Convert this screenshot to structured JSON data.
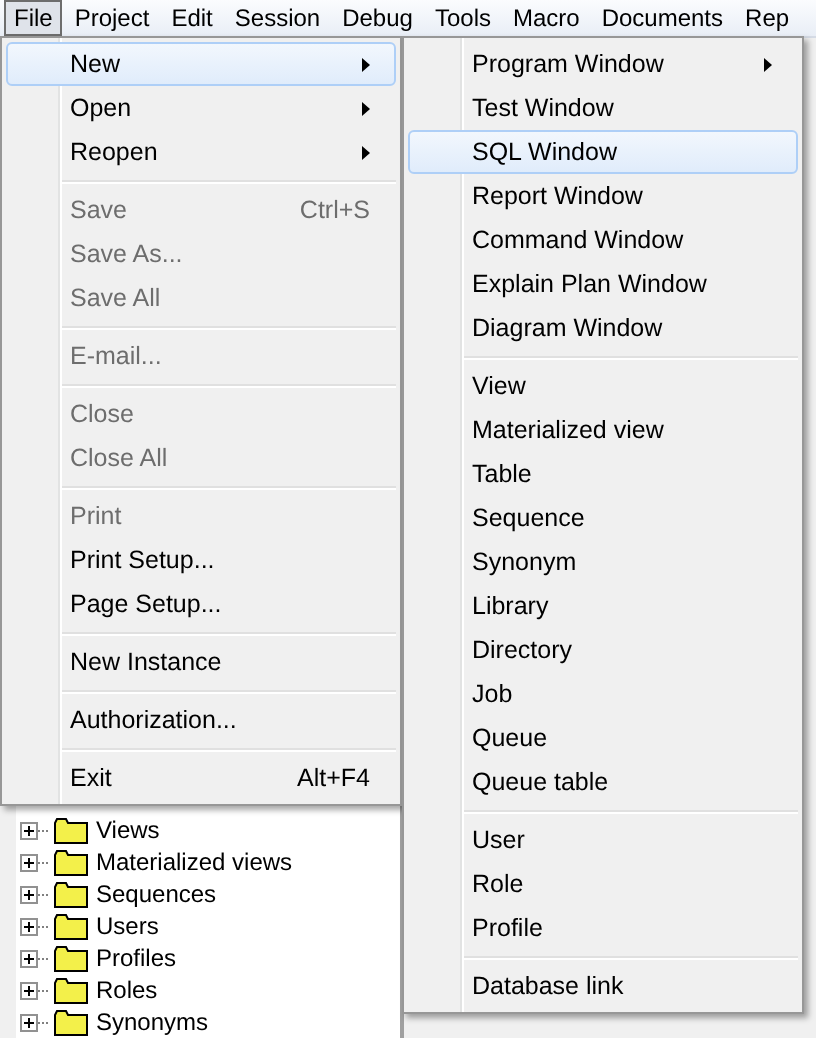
{
  "menubar": [
    {
      "label": "File",
      "selected": true
    },
    {
      "label": "Project",
      "selected": false
    },
    {
      "label": "Edit",
      "selected": false
    },
    {
      "label": "Session",
      "selected": false
    },
    {
      "label": "Debug",
      "selected": false
    },
    {
      "label": "Tools",
      "selected": false
    },
    {
      "label": "Macro",
      "selected": false
    },
    {
      "label": "Documents",
      "selected": false
    },
    {
      "label": "Rep",
      "selected": false
    }
  ],
  "file_menu": [
    {
      "kind": "item",
      "label": "New",
      "has_submenu": true,
      "disabled": false,
      "selected": true
    },
    {
      "kind": "item",
      "label": "Open",
      "has_submenu": true,
      "disabled": false,
      "selected": false
    },
    {
      "kind": "item",
      "label": "Reopen",
      "has_submenu": true,
      "disabled": false,
      "selected": false
    },
    {
      "kind": "separator"
    },
    {
      "kind": "item",
      "label": "Save",
      "shortcut": "Ctrl+S",
      "disabled": true,
      "selected": false
    },
    {
      "kind": "item",
      "label": "Save As...",
      "disabled": true,
      "selected": false
    },
    {
      "kind": "item",
      "label": "Save All",
      "disabled": true,
      "selected": false
    },
    {
      "kind": "separator"
    },
    {
      "kind": "item",
      "label": "E-mail...",
      "disabled": true,
      "selected": false
    },
    {
      "kind": "separator"
    },
    {
      "kind": "item",
      "label": "Close",
      "disabled": true,
      "selected": false
    },
    {
      "kind": "item",
      "label": "Close All",
      "disabled": true,
      "selected": false
    },
    {
      "kind": "separator"
    },
    {
      "kind": "item",
      "label": "Print",
      "disabled": true,
      "selected": false
    },
    {
      "kind": "item",
      "label": "Print Setup...",
      "disabled": false,
      "selected": false
    },
    {
      "kind": "item",
      "label": "Page Setup...",
      "disabled": false,
      "selected": false
    },
    {
      "kind": "separator"
    },
    {
      "kind": "item",
      "label": "New Instance",
      "disabled": false,
      "selected": false
    },
    {
      "kind": "separator"
    },
    {
      "kind": "item",
      "label": "Authorization...",
      "disabled": false,
      "selected": false
    },
    {
      "kind": "separator"
    },
    {
      "kind": "item",
      "label": "Exit",
      "shortcut": "Alt+F4",
      "disabled": false,
      "selected": false
    }
  ],
  "new_submenu": [
    {
      "kind": "item",
      "label": "Program Window",
      "has_submenu": true,
      "disabled": false,
      "selected": false
    },
    {
      "kind": "item",
      "label": "Test Window",
      "disabled": false,
      "selected": false
    },
    {
      "kind": "item",
      "label": "SQL Window",
      "disabled": false,
      "selected": true
    },
    {
      "kind": "item",
      "label": "Report Window",
      "disabled": false,
      "selected": false
    },
    {
      "kind": "item",
      "label": "Command Window",
      "disabled": false,
      "selected": false
    },
    {
      "kind": "item",
      "label": "Explain Plan Window",
      "disabled": false,
      "selected": false
    },
    {
      "kind": "item",
      "label": "Diagram Window",
      "disabled": false,
      "selected": false
    },
    {
      "kind": "separator"
    },
    {
      "kind": "item",
      "label": "View",
      "disabled": false,
      "selected": false
    },
    {
      "kind": "item",
      "label": "Materialized view",
      "disabled": false,
      "selected": false
    },
    {
      "kind": "item",
      "label": "Table",
      "disabled": false,
      "selected": false
    },
    {
      "kind": "item",
      "label": "Sequence",
      "disabled": false,
      "selected": false
    },
    {
      "kind": "item",
      "label": "Synonym",
      "disabled": false,
      "selected": false
    },
    {
      "kind": "item",
      "label": "Library",
      "disabled": false,
      "selected": false
    },
    {
      "kind": "item",
      "label": "Directory",
      "disabled": false,
      "selected": false
    },
    {
      "kind": "item",
      "label": "Job",
      "disabled": false,
      "selected": false
    },
    {
      "kind": "item",
      "label": "Queue",
      "disabled": false,
      "selected": false
    },
    {
      "kind": "item",
      "label": "Queue table",
      "disabled": false,
      "selected": false
    },
    {
      "kind": "separator"
    },
    {
      "kind": "item",
      "label": "User",
      "disabled": false,
      "selected": false
    },
    {
      "kind": "item",
      "label": "Role",
      "disabled": false,
      "selected": false
    },
    {
      "kind": "item",
      "label": "Profile",
      "disabled": false,
      "selected": false
    },
    {
      "kind": "separator"
    },
    {
      "kind": "item",
      "label": "Database link",
      "disabled": false,
      "selected": false
    }
  ],
  "object_tree": [
    {
      "label": "Views",
      "expanded": false
    },
    {
      "label": "Materialized views",
      "expanded": false
    },
    {
      "label": "Sequences",
      "expanded": false
    },
    {
      "label": "Users",
      "expanded": false
    },
    {
      "label": "Profiles",
      "expanded": false
    },
    {
      "label": "Roles",
      "expanded": false
    },
    {
      "label": "Synonyms",
      "expanded": false
    }
  ]
}
